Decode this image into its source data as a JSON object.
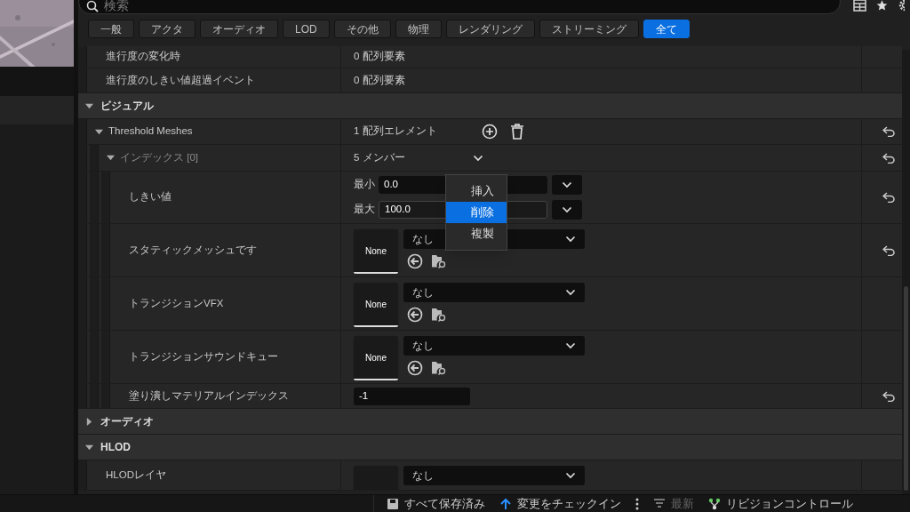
{
  "search": {
    "placeholder": "検索"
  },
  "filters": [
    {
      "label": "一般",
      "selected": false
    },
    {
      "label": "アクタ",
      "selected": false
    },
    {
      "label": "オーディオ",
      "selected": false
    },
    {
      "label": "LOD",
      "selected": false
    },
    {
      "label": "その他",
      "selected": false
    },
    {
      "label": "物理",
      "selected": false
    },
    {
      "label": "レンダリング",
      "selected": false
    },
    {
      "label": "ストリーミング",
      "selected": false
    },
    {
      "label": "全て",
      "selected": true
    }
  ],
  "rows": [
    {
      "kind": "property",
      "label": "進行度の変化時",
      "value": "0 配列要素"
    },
    {
      "kind": "property",
      "label": "進行度のしきい値超過イベント",
      "value": "0 配列要素"
    },
    {
      "kind": "section",
      "label": "ビジュアル",
      "expanded": true,
      "children": [
        {
          "kind": "array",
          "label": "Threshold Meshes",
          "expanded": true,
          "value": "1 配列エレメント",
          "resettable": true,
          "children": [
            {
              "kind": "struct",
              "label": "インデックス [0]",
              "expanded": true,
              "value": "5 メンバー",
              "resettable": true,
              "children": [
                {
                  "kind": "range",
                  "label": "しきい値",
                  "fields": [
                    {
                      "label": "最小",
                      "value": "0.0"
                    },
                    {
                      "label": "最大",
                      "value": "100.0"
                    }
                  ],
                  "resettable": true
                },
                {
                  "kind": "asset",
                  "label": "スタティックメッシュです",
                  "thumbnail": "None",
                  "value": "なし",
                  "resettable": true
                },
                {
                  "kind": "asset",
                  "label": "トランジションVFX",
                  "thumbnail": "None",
                  "value": "なし",
                  "resettable": false
                },
                {
                  "kind": "asset",
                  "label": "トランジションサウンドキュー",
                  "thumbnail": "None",
                  "value": "なし",
                  "resettable": false
                },
                {
                  "kind": "number",
                  "label": "塗り潰しマテリアルインデックス",
                  "value": "-1",
                  "resettable": true
                }
              ]
            }
          ]
        }
      ]
    },
    {
      "kind": "section",
      "label": "オーディオ",
      "expanded": false
    },
    {
      "kind": "section",
      "label": "HLOD",
      "expanded": true,
      "children": [
        {
          "kind": "asset",
          "label": "HLODレイヤ",
          "value": "なし",
          "resettable": false
        }
      ]
    }
  ],
  "context_menu": [
    {
      "label": "挿入",
      "selected": false
    },
    {
      "label": "削除",
      "selected": true
    },
    {
      "label": "複製",
      "selected": false
    }
  ],
  "status_bar": [
    {
      "kind": "save",
      "label": "すべて保存済み",
      "disabled": false
    },
    {
      "kind": "checkin",
      "label": "変更をチェックイン",
      "disabled": false
    },
    {
      "kind": "sync",
      "label": "最新",
      "disabled": true
    },
    {
      "kind": "revision",
      "label": "リビジョンコントロール",
      "disabled": false
    }
  ]
}
